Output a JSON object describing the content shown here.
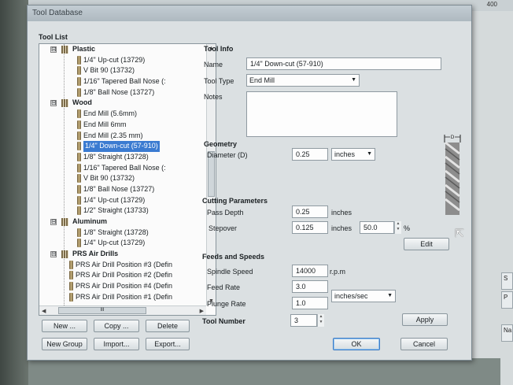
{
  "background": {
    "ruler_number": "400",
    "right_side_labels": [
      "S",
      "P",
      "Na"
    ]
  },
  "dialog": {
    "title": "Tool Database",
    "tool_list": {
      "heading": "Tool List",
      "items": [
        {
          "type": "group",
          "label": "Plastic",
          "expander": "⊟"
        },
        {
          "type": "tool",
          "label": "1/4\" Up-cut (13729)"
        },
        {
          "type": "tool",
          "label": "V Bit 90 (13732)"
        },
        {
          "type": "tool",
          "label": "1/16\" Tapered Ball Nose (:"
        },
        {
          "type": "tool",
          "label": "1/8\" Ball Nose (13727)"
        },
        {
          "type": "group",
          "label": "Wood",
          "expander": "⊟"
        },
        {
          "type": "tool",
          "label": "End Mill (5.6mm)"
        },
        {
          "type": "tool",
          "label": "End Mill 6mm"
        },
        {
          "type": "tool",
          "label": "End Mill (2.35 mm)"
        },
        {
          "type": "tool",
          "label": "1/4\" Down-cut (57-910)",
          "selected": true
        },
        {
          "type": "tool",
          "label": "1/8\" Straight (13728)"
        },
        {
          "type": "tool",
          "label": "1/16\" Tapered Ball Nose (:"
        },
        {
          "type": "tool",
          "label": "V Bit 90 (13732)"
        },
        {
          "type": "tool",
          "label": "1/8\" Ball Nose (13727)"
        },
        {
          "type": "tool",
          "label": "1/4\" Up-cut (13729)"
        },
        {
          "type": "tool",
          "label": "1/2\" Straight (13733)"
        },
        {
          "type": "group",
          "label": "Aluminum",
          "expander": "⊟"
        },
        {
          "type": "tool",
          "label": "1/8\" Straight (13728)"
        },
        {
          "type": "tool",
          "label": "1/4\" Up-cut (13729)"
        },
        {
          "type": "group",
          "label": "PRS Air Drills",
          "expander": "⊟"
        },
        {
          "type": "drill",
          "label": "PRS Air Drill Position #3 (Defin"
        },
        {
          "type": "drill",
          "label": "PRS Air Drill Position #2 (Defin"
        },
        {
          "type": "drill",
          "label": "PRS Air Drill Position #4 (Defin"
        },
        {
          "type": "drill",
          "label": "PRS Air Drill Position #1 (Defin"
        }
      ],
      "scroll_thumb_glyph": "III"
    },
    "list_buttons": {
      "new": "New ...",
      "copy": "Copy ...",
      "delete": "Delete",
      "new_group": "New Group",
      "import": "Import...",
      "export": "Export..."
    },
    "tool_info": {
      "heading": "Tool Info",
      "name_label": "Name",
      "name_value": "1/4\" Down-cut (57-910)",
      "type_label": "Tool Type",
      "type_value": "End Mill",
      "notes_label": "Notes",
      "notes_value": ""
    },
    "geometry": {
      "heading": "Geometry",
      "diameter_label": "Diameter (D)",
      "diameter_value": "0.25",
      "units_value": "inches",
      "preview_label": "D"
    },
    "cutting": {
      "heading": "Cutting Parameters",
      "pass_depth_label": "Pass Depth",
      "pass_depth_value": "0.25",
      "pass_depth_unit": "inches",
      "stepover_label": "Stepover",
      "stepover_value": "0.125",
      "stepover_unit": "inches",
      "stepover_percent": "50.0",
      "percent_sign": "%",
      "edit_button": "Edit"
    },
    "feeds": {
      "heading": "Feeds and Speeds",
      "spindle_label": "Spindle Speed",
      "spindle_value": "14000",
      "spindle_unit": "r.p.m",
      "feed_label": "Feed Rate",
      "feed_value": "3.0",
      "plunge_label": "Plunge Rate",
      "plunge_value": "1.0",
      "rate_units": "inches/sec"
    },
    "tool_number": {
      "label": "Tool Number",
      "value": "3"
    },
    "apply_button": "Apply",
    "ok_button": "OK",
    "cancel_button": "Cancel"
  }
}
